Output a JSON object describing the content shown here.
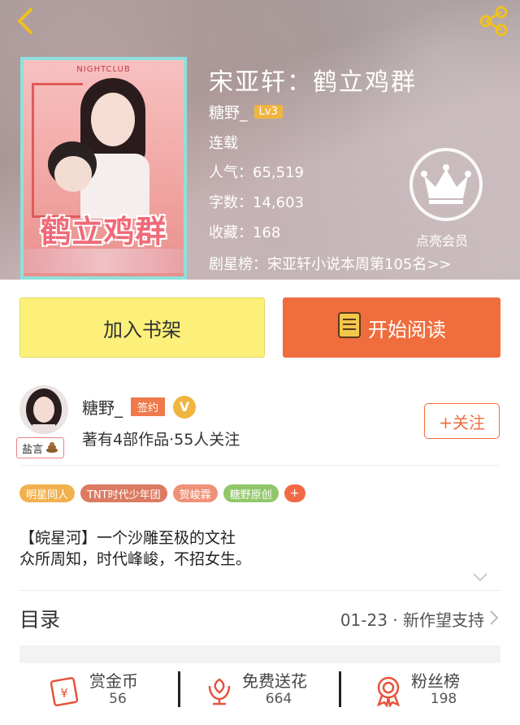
{
  "book": {
    "title": "宋亚轩：鹤立鸡群",
    "author": "糖野_",
    "level": "Lv3",
    "status": "连载",
    "popularity": "人气：65,519",
    "word_count": "字数：14,603",
    "collections": "收藏：168",
    "weekly_rank": "剧星榜：宋亚轩小说本周第105名>>",
    "cover": {
      "top_text": "NIGHTCLUB",
      "title": "鹤立鸡群"
    }
  },
  "vip": {
    "label": "点亮会员",
    "icon": "crown-icon"
  },
  "actions": {
    "shelf": "加入书架",
    "read": "开始阅读"
  },
  "author_card": {
    "name": "糖野_",
    "sign_badge": "签约",
    "vip_badge": "V",
    "stats": "著有4部作品·55人关注",
    "follow": "+关注",
    "tag": "盐言",
    "tag_icon": "poop-emoji"
  },
  "tags": [
    {
      "label": "明星同人",
      "color": "#f2b14e"
    },
    {
      "label": "TNT时代少年团",
      "color": "#dc7a62"
    },
    {
      "label": "贺峻霖",
      "color": "#ee9277"
    },
    {
      "label": "糖野原创",
      "color": "#91c76a"
    },
    {
      "label": "+",
      "color": "#f26a45"
    }
  ],
  "description": {
    "line1": "【皖星河】一个沙雕至极的文社",
    "line2": "众所周知，时代峰峻，不招女生。"
  },
  "toc": {
    "label": "目录",
    "update": "01-23 · 新作望支持"
  },
  "stats": [
    {
      "label": "赏金币",
      "value": "56",
      "icon": "red-envelope-icon"
    },
    {
      "label": "免费送花",
      "value": "664",
      "icon": "flower-icon"
    },
    {
      "label": "粉丝榜",
      "value": "198",
      "icon": "medal-icon"
    }
  ]
}
